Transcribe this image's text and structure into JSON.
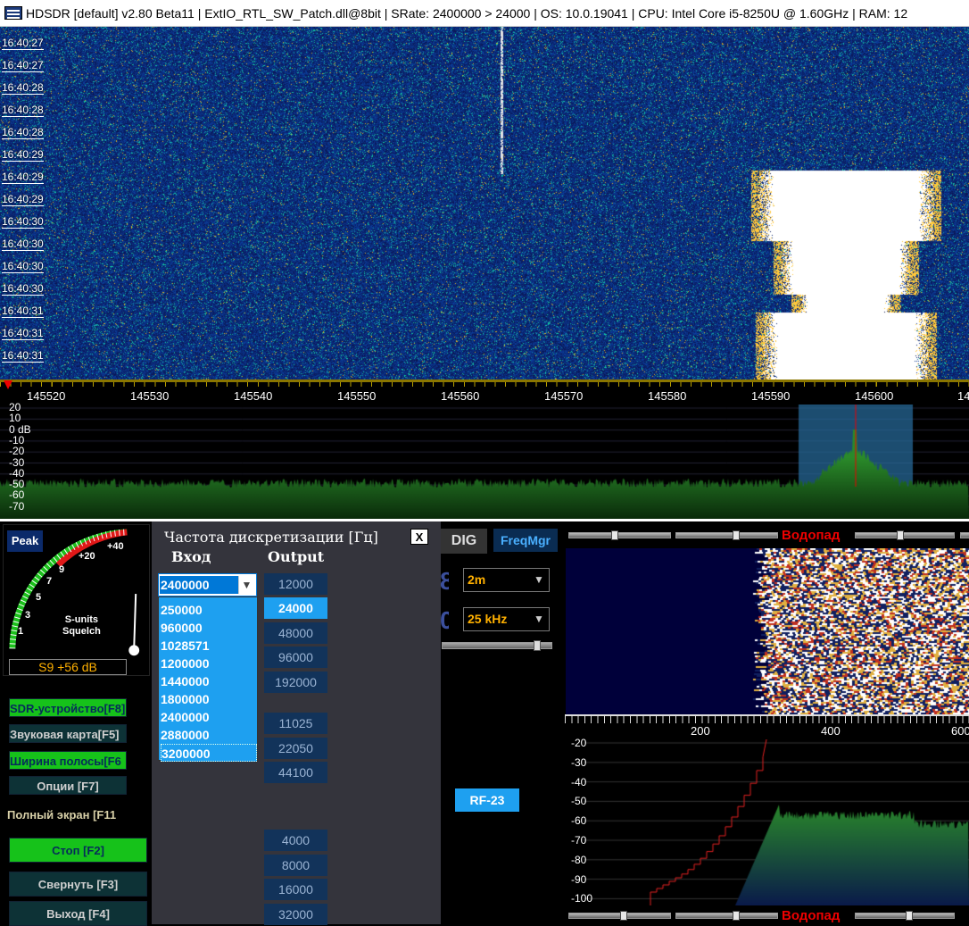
{
  "titlebar": {
    "text": "HDSDR  [default]  v2.80 Beta11  |  ExtIO_RTL_SW_Patch.dll@8bit  |  SRate: 2400000 > 24000  |  OS: 10.0.19041   | CPU: Intel Core i5-8250U @ 1.60GHz  |  RAM: 12"
  },
  "waterfall": {
    "timestamps": [
      "16:40:27",
      "16:40:27",
      "16:40:28",
      "16:40:28",
      "16:40:28",
      "16:40:29",
      "16:40:29",
      "16:40:29",
      "16:40:30",
      "16:40:30",
      "16:40:30",
      "16:40:30",
      "16:40:31",
      "16:40:31",
      "16:40:31"
    ]
  },
  "freq_ruler": {
    "labels": [
      "145520",
      "145530",
      "145540",
      "145550",
      "145560",
      "145570",
      "145580",
      "145590",
      "145600",
      "14"
    ]
  },
  "spectrum": {
    "db_labels": [
      "20",
      "10",
      "0 dB",
      "-10",
      "-20",
      "-30",
      "-40",
      "-50",
      "-60",
      "-70"
    ]
  },
  "smeter": {
    "peak_label": "Peak",
    "scale": [
      "1",
      "3",
      "5",
      "7",
      "9",
      "+20",
      "+40"
    ],
    "caption_line1": "S-units",
    "caption_line2": "Squelch",
    "reading": "S9 +56 dB"
  },
  "left_buttons": {
    "sdr_device": "SDR-устройство[F8]",
    "sound_card": "Звуковая карта[F5]",
    "bandwidth": "Ширина полосы[F6",
    "options": "Опции    [F7]",
    "fullscreen": "Полный экран [F11",
    "stop": "Стоп         [F2]",
    "minimize": "Свернуть  [F3]",
    "exit": "Выход       [F4]"
  },
  "dialog": {
    "title": "Частота дискретизации [Гц]",
    "close": "X",
    "input_header": "Вход",
    "output_header": "Output",
    "input_value": "2400000",
    "input_options": [
      "250000",
      "960000",
      "1028571",
      "1200000",
      "1440000",
      "1800000",
      "2400000",
      "2880000",
      "3200000"
    ],
    "output_rates": [
      "12000",
      "24000",
      "48000",
      "96000",
      "192000",
      "11025",
      "22050",
      "44100",
      "4000",
      "8000",
      "16000",
      "32000"
    ],
    "selected_output": "24000"
  },
  "controls": {
    "dig": "DIG",
    "freqmgr": "FreqMgr",
    "band": "2m",
    "step": "25 kHz",
    "rf_button": "RF-23"
  },
  "af_panel": {
    "waterfall_label": "Водопад",
    "ruler_labels": [
      "200",
      "400",
      "600"
    ],
    "db_labels": [
      "-20",
      "-30",
      "-40",
      "-50",
      "-60",
      "-70",
      "-80",
      "-90",
      "-100"
    ]
  },
  "colors": {
    "accent_blue": "#1ea0f0",
    "active_green": "#16c21a",
    "reading_orange": "#ffb000",
    "waterfall_label_red": "#e00000"
  }
}
